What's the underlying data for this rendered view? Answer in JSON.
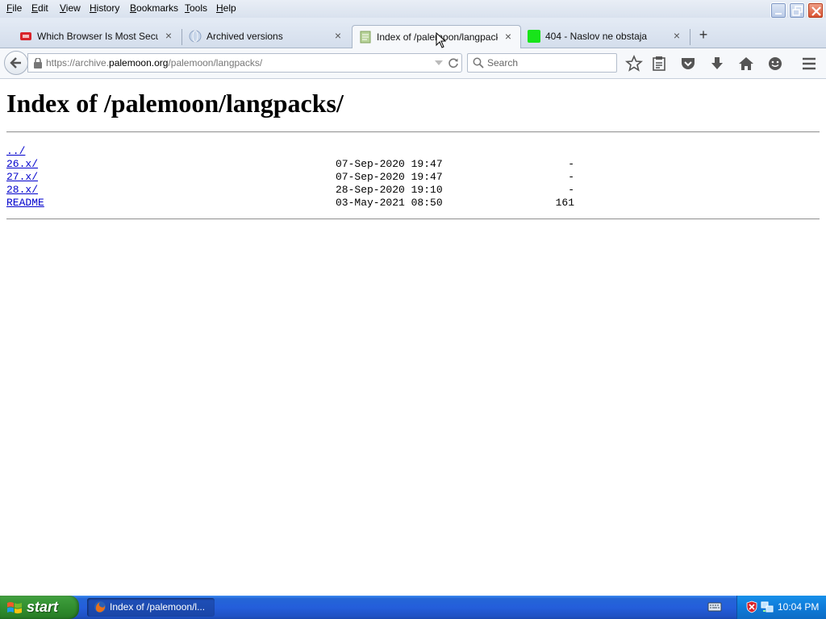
{
  "menubar": {
    "items": [
      "File",
      "Edit",
      "View",
      "History",
      "Bookmarks",
      "Tools",
      "Help"
    ]
  },
  "tabs": [
    {
      "label": "Which Browser Is Most Secur...",
      "favicon": "hd-red-icon",
      "active": false
    },
    {
      "label": "Archived versions",
      "favicon": "globe-icon",
      "active": false
    },
    {
      "label": "Index of /palemoon/langpacks/",
      "favicon": "page-icon",
      "active": true
    },
    {
      "label": "404 - Naslov ne obstaja",
      "favicon": "green-square-icon",
      "active": false
    }
  ],
  "navbar": {
    "url_prefix": "https://archive.",
    "url_host": "palemoon.org",
    "url_path": "/palemoon/langpacks/",
    "search_placeholder": "Search"
  },
  "page": {
    "heading": "Index of /palemoon/langpacks/",
    "entries": [
      {
        "name": "../",
        "date": "",
        "size": ""
      },
      {
        "name": "26.x/",
        "date": "07-Sep-2020 19:47",
        "size": "-"
      },
      {
        "name": "27.x/",
        "date": "07-Sep-2020 19:47",
        "size": "-"
      },
      {
        "name": "28.x/",
        "date": "28-Sep-2020 19:10",
        "size": "-"
      },
      {
        "name": "README",
        "date": "03-May-2021 08:50",
        "size": "161"
      }
    ]
  },
  "taskbar": {
    "start_label": "start",
    "task_label": "Index of /palemoon/l...",
    "clock": "10:04 PM"
  },
  "colors": {
    "link": "#0000cc",
    "taskbar_blue": "#245edb",
    "start_green": "#3c9b3a"
  }
}
